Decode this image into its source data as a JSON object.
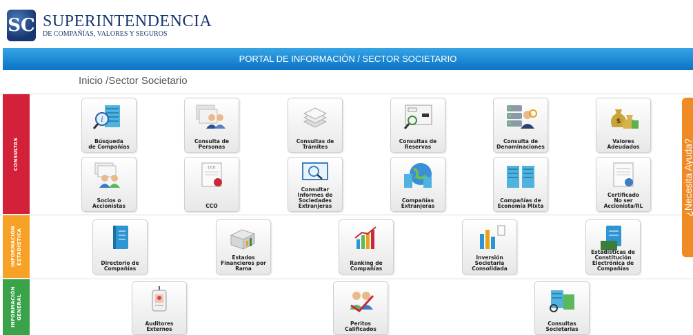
{
  "header": {
    "logo_mark": "SC",
    "title": "SUPERINTENDENCIA",
    "subtitle": "DE COMPAÑÍAS, VALORES Y SEGUROS"
  },
  "banner": "PORTAL DE INFORMACIÓN / SECTOR SOCIETARIO",
  "breadcrumb": "Inicio /Sector Societario",
  "help_label": "¿Necesita Ayuda?",
  "sections": {
    "consultas": {
      "label": "CONSULTAS",
      "tiles": [
        {
          "label": "Búsqueda\nde Compañías",
          "icon": "building-search-icon"
        },
        {
          "label": "Consulta de\nPersonas",
          "icon": "people-icon"
        },
        {
          "label": "Consultas de\nTrámites",
          "icon": "papers-icon"
        },
        {
          "label": "Consultas de\nReservas",
          "icon": "document-search-icon"
        },
        {
          "label": "Consulta de\nDenominaciones",
          "icon": "server-user-icon"
        },
        {
          "label": "Valores\nAdeudados",
          "icon": "money-bags-icon"
        },
        {
          "label": "Socios o\nAccionistas",
          "icon": "partners-icon"
        },
        {
          "label": "CCO",
          "icon": "certificate-seal-icon"
        },
        {
          "label": "Consultar\nInformes de\nSociedades\nExtranjeras",
          "icon": "screen-search-icon"
        },
        {
          "label": "Compañías\nExtranjeras",
          "icon": "globe-buildings-icon"
        },
        {
          "label": "Compañías de\nEconomía Mixta",
          "icon": "twin-buildings-icon"
        },
        {
          "label": "Certificado\nNo ser\nAccionista/RL",
          "icon": "certificate-icon"
        }
      ]
    },
    "estadistica": {
      "label": "INFORMACIÓN ESTADÍSTICA",
      "tiles": [
        {
          "label": "Directorio de\nCompañías",
          "icon": "book-icon"
        },
        {
          "label": "Estados\nFinancieros por\nRama",
          "icon": "boxes-chart-icon"
        },
        {
          "label": "Ranking de\nCompañías",
          "icon": "ranking-chart-icon"
        },
        {
          "label": "Inversión\nSocietaria\nConsolidada",
          "icon": "bar-chart-icon"
        },
        {
          "label": "Estadísticas de\nConstitución\nElectrónica de\nCompañías",
          "icon": "ebook-icon"
        }
      ]
    },
    "general": {
      "label": "INFORMACIÓN GENERAL",
      "tiles": [
        {
          "label": "Auditores\nExternos",
          "icon": "id-badge-icon"
        },
        {
          "label": "Peritos\nCalificados",
          "icon": "approved-people-icon"
        },
        {
          "label": "Consultas\nSocietarias",
          "icon": "buildings-search-icon"
        }
      ]
    }
  },
  "colors": {
    "brand": "#16366e",
    "banner": "#1a86d6",
    "consultas": "#d4213a",
    "estadistica": "#f7a126",
    "general": "#3aa34a",
    "help": "#f08a24"
  }
}
